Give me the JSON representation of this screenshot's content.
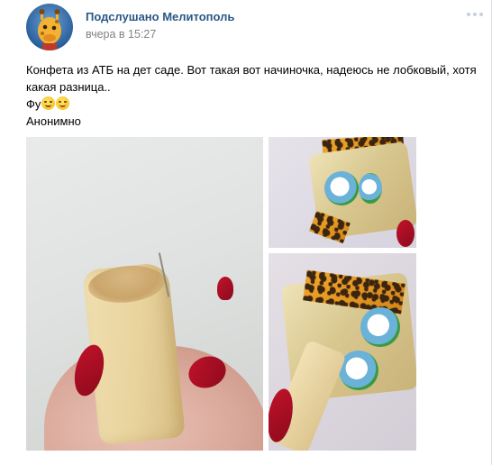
{
  "post": {
    "author": "Подслушано Мелитополь",
    "date": "вчера в 15:27",
    "text_line1": "Конфета из АТБ на дет саде. Вот такая вот начиночка, надеюсь не лобковый, хотя",
    "text_line2": "какая разница..",
    "text_line3_prefix": "Фу",
    "text_line4": "Анонимно",
    "emojis": [
      "grimacing-face-icon",
      "relieved-face-icon"
    ]
  },
  "photos": [
    {
      "name": "photo-candy-in-hand"
    },
    {
      "name": "photo-candy-wrapper"
    },
    {
      "name": "photo-candy-and-wrapper"
    }
  ],
  "colors": {
    "link": "#2a5885",
    "meta": "#828282",
    "text": "#000000"
  }
}
